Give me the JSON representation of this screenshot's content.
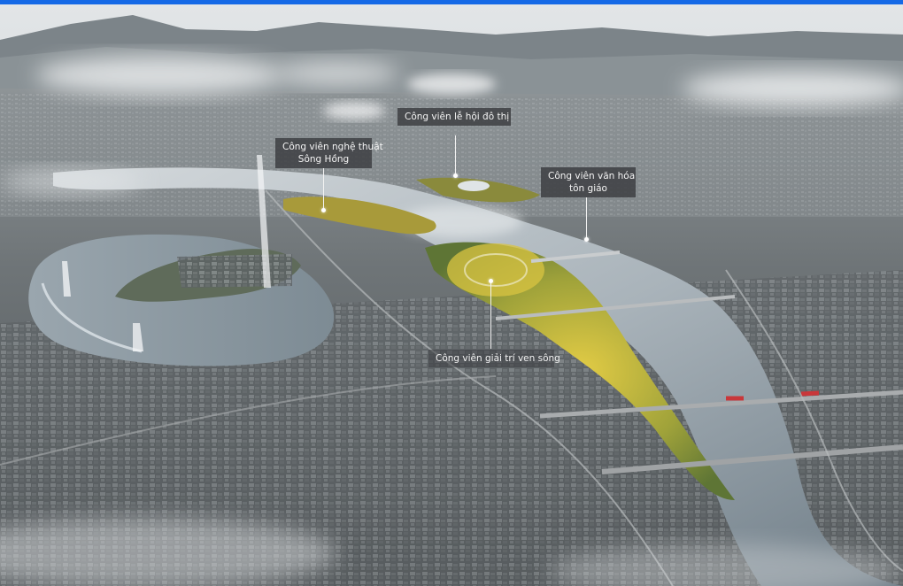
{
  "image": {
    "subject": "Aerial rendering of a river city with riverside parks",
    "colors": {
      "topbar": "#1569e6",
      "river": "#a7b1b8",
      "city": "#6a6e70",
      "park": "#c9b43a",
      "sky": "#d7dbde"
    }
  },
  "callouts": {
    "festival_park": "Công viên lễ hội đô thị",
    "art_park_line1": "Công viên nghệ thuật",
    "art_park_line2": "Sông Hồng",
    "culture_park_line1": "Công viên văn hóa",
    "culture_park_line2": "tôn giáo",
    "riverside_park": "Công viên giải trí ven sông"
  }
}
